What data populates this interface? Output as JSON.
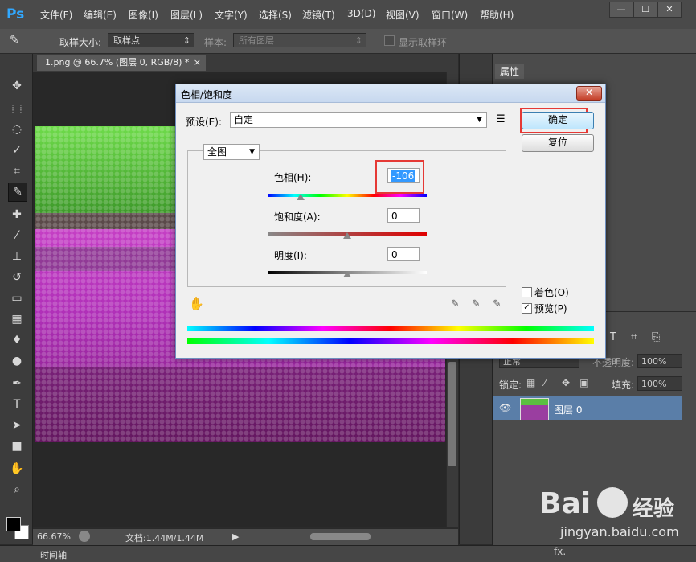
{
  "app": {
    "logo": "Ps"
  },
  "menu": [
    "文件(F)",
    "编辑(E)",
    "图像(I)",
    "图层(L)",
    "文字(Y)",
    "选择(S)",
    "滤镜(T)",
    "3D(D)",
    "视图(V)",
    "窗口(W)",
    "帮助(H)"
  ],
  "window_controls": {
    "minimize": "—",
    "restore": "☐",
    "close": "✕"
  },
  "options_bar": {
    "sample_size_label": "取样大小:",
    "sample_size_value": "取样点",
    "sample_label": "样本:",
    "sample_value": "所有图层",
    "show_ring_label": "显示取样环"
  },
  "document": {
    "tab_title": "1.png @ 66.7% (图层 0, RGB/8) *",
    "tab_close": "×",
    "zoom": "66.67%",
    "doc_info": "文档:1.44M/1.44M"
  },
  "timeline": {
    "label": "时间轴"
  },
  "properties_panel": {
    "tab_label": "属性"
  },
  "layers_panel": {
    "blend_mode": "正常",
    "opacity_label": "不透明度:",
    "opacity_value": "100%",
    "lock_label": "锁定:",
    "fill_label": "填充:",
    "fill_value": "100%",
    "layer_name": "图层 0"
  },
  "dialog": {
    "title": "色相/饱和度",
    "close": "✕",
    "preset_label": "预设(E):",
    "preset_value": "自定",
    "channel_value": "全图",
    "ok_label": "确定",
    "reset_label": "复位",
    "hue_label": "色相(H):",
    "hue_value": "-106",
    "saturation_label": "饱和度(A):",
    "saturation_value": "0",
    "lightness_label": "明度(I):",
    "lightness_value": "0",
    "colorize_label": "着色(O)",
    "colorize_checked": false,
    "preview_label": "预览(P)",
    "preview_checked": true,
    "hue_level": -106,
    "saturation_level": 0,
    "lightness_level": 0
  },
  "watermark": {
    "brand": "Bai",
    "brand2": "经验",
    "url": "jingyan.baidu.com"
  },
  "colors": {
    "accent_highlight": "#e53935",
    "dialog_bg": "#f0f0f0",
    "selected_layer": "#5a7ea8",
    "ps_blue": "#31a8ff"
  }
}
